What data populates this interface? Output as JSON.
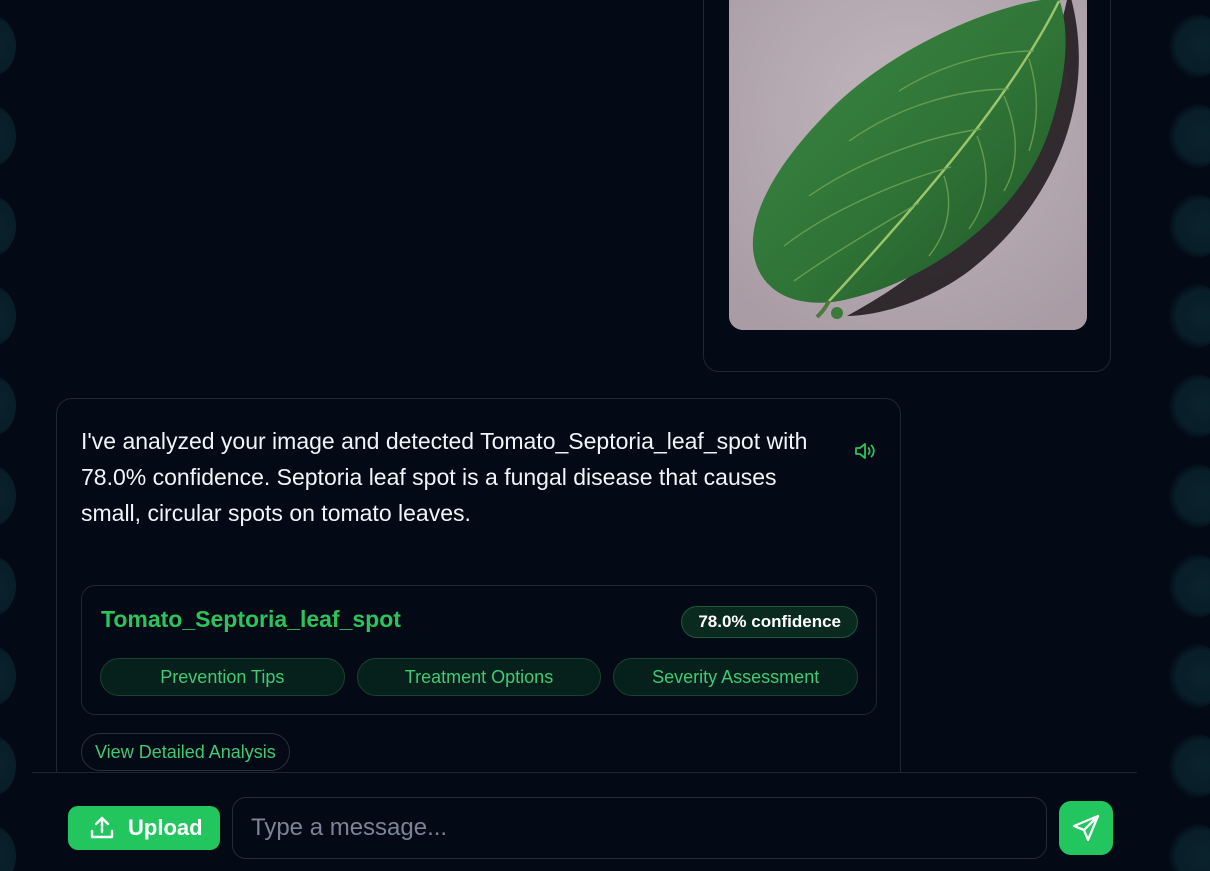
{
  "conversation": {
    "user_image": {
      "icon": "leaf-photo"
    },
    "assistant_message": {
      "text": "I've analyzed your image and detected Tomato_Septoria_leaf_spot with 78.0% confidence. Septoria leaf spot is a fungal disease that causes small, circular spots on tomato leaves.",
      "speaker_icon": "speaker-icon",
      "diagnosis": {
        "disease_name": "Tomato_Septoria_leaf_spot",
        "confidence_label": "78.0% confidence",
        "confidence": 0.78,
        "actions": [
          {
            "label": "Prevention Tips"
          },
          {
            "label": "Treatment Options"
          },
          {
            "label": "Severity Assessment"
          }
        ]
      },
      "detail_button_label": "View Detailed Analysis"
    }
  },
  "composer": {
    "upload_label": "Upload",
    "upload_icon": "upload-icon",
    "input_placeholder": "Type a message...",
    "input_value": "",
    "send_icon": "send-icon"
  },
  "colors": {
    "background": "#030a16",
    "accent": "#22c55e",
    "accent_text": "#2bc35b",
    "border": "#1d2736"
  }
}
